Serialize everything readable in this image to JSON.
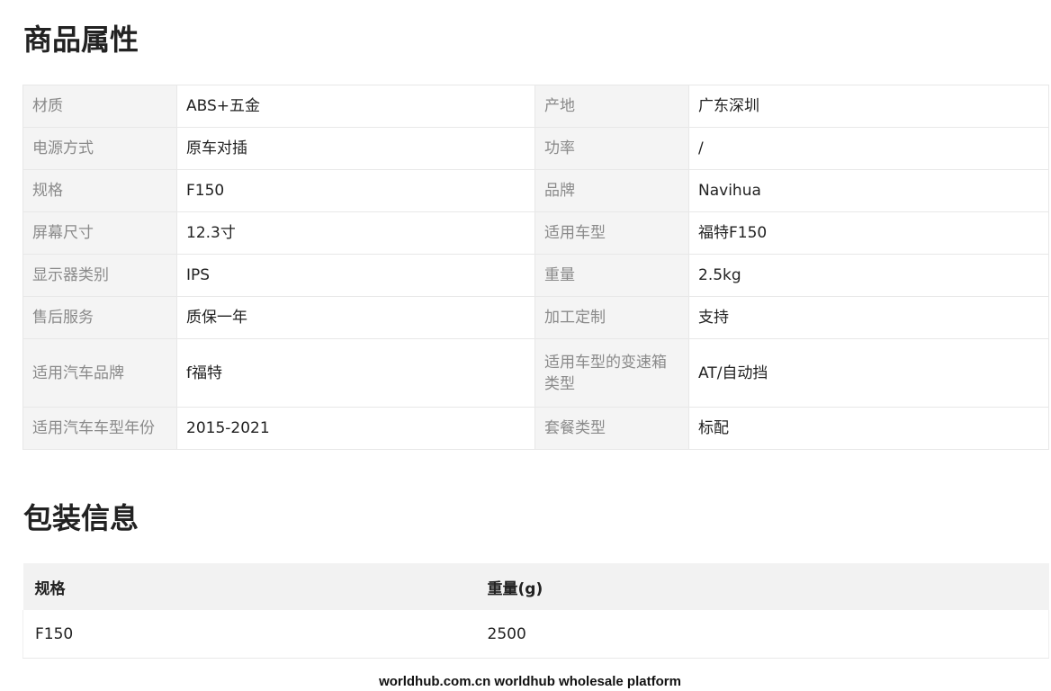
{
  "attributes": {
    "title": "商品属性",
    "rows": [
      {
        "k1": "材质",
        "v1": "ABS+五金",
        "k2": "产地",
        "v2": "广东深圳"
      },
      {
        "k1": "电源方式",
        "v1": "原车对插",
        "k2": "功率",
        "v2": "/"
      },
      {
        "k1": "规格",
        "v1": "F150",
        "k2": "品牌",
        "v2": "Navihua"
      },
      {
        "k1": "屏幕尺寸",
        "v1": "12.3寸",
        "k2": "适用车型",
        "v2": "福特F150"
      },
      {
        "k1": "显示器类别",
        "v1": "IPS",
        "k2": "重量",
        "v2": "2.5kg"
      },
      {
        "k1": "售后服务",
        "v1": "质保一年",
        "k2": "加工定制",
        "v2": "支持"
      },
      {
        "k1": "适用汽车品牌",
        "v1": "f福特",
        "k2": "适用车型的变速箱类型",
        "v2": "AT/自动挡"
      },
      {
        "k1": "适用汽车车型年份",
        "v1": "2015-2021",
        "k2": "套餐类型",
        "v2": "标配"
      }
    ]
  },
  "packaging": {
    "title": "包装信息",
    "headers": [
      "规格",
      "重量(g)"
    ],
    "rows": [
      [
        "F150",
        "2500"
      ]
    ]
  },
  "footer": {
    "text": "worldhub.com.cn worldhub wholesale platform"
  }
}
